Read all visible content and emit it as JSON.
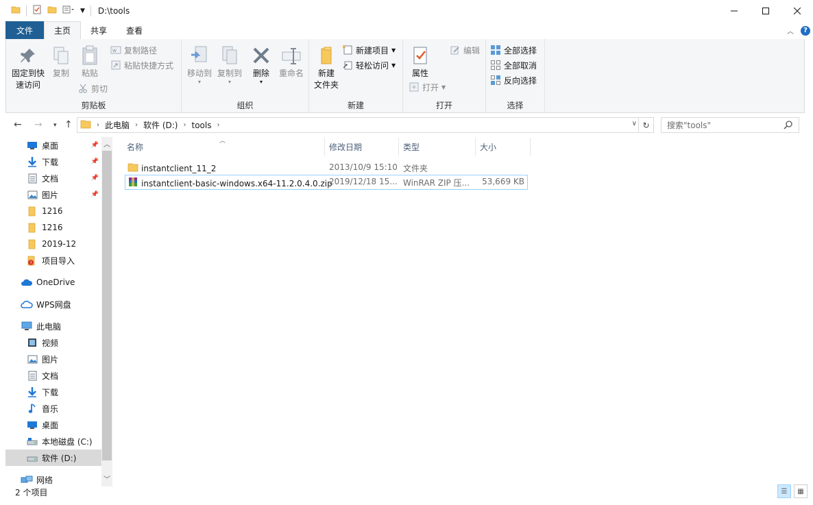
{
  "window": {
    "title": "D:\\tools"
  },
  "ribbon_tabs": [
    "文件",
    "主页",
    "共享",
    "查看"
  ],
  "ribbon": {
    "clipboard": {
      "label": "剪贴板",
      "pin_label_1": "固定到快",
      "pin_label_2": "速访问",
      "copy": "复制",
      "paste": "粘贴",
      "copy_path": "复制路径",
      "paste_shortcut": "粘贴快捷方式",
      "cut": "剪切"
    },
    "organize": {
      "label": "组织",
      "move_to": "移动到",
      "copy_to": "复制到",
      "delete": "删除",
      "rename": "重命名"
    },
    "new": {
      "label": "新建",
      "new_folder_1": "新建",
      "new_folder_2": "文件夹",
      "new_item": "新建项目",
      "easy_access": "轻松访问"
    },
    "open": {
      "label": "打开",
      "properties": "属性",
      "open": "打开",
      "edit": "编辑"
    },
    "select": {
      "label": "选择",
      "select_all": "全部选择",
      "select_none": "全部取消",
      "invert": "反向选择"
    }
  },
  "address": {
    "segments": [
      "此电脑",
      "软件 (D:)",
      "tools"
    ],
    "search_placeholder": "搜索\"tools\""
  },
  "nav": {
    "quick": [
      {
        "label": "桌面",
        "icon": "desktop-icon",
        "pinned": true
      },
      {
        "label": "下载",
        "icon": "download-icon",
        "pinned": true
      },
      {
        "label": "文档",
        "icon": "document-icon",
        "pinned": true
      },
      {
        "label": "图片",
        "icon": "pictures-icon",
        "pinned": true
      },
      {
        "label": "1216",
        "icon": "folder-icon",
        "pinned": false
      },
      {
        "label": "1216",
        "icon": "folder-icon",
        "pinned": false
      },
      {
        "label": "2019-12",
        "icon": "folder-icon",
        "pinned": false
      },
      {
        "label": "项目导入",
        "icon": "folder-warning-icon",
        "pinned": false
      }
    ],
    "onedrive": "OneDrive",
    "wps": "WPS网盘",
    "thispc": "此电脑",
    "pc_items": [
      {
        "label": "视频",
        "icon": "video-icon"
      },
      {
        "label": "图片",
        "icon": "pictures-icon"
      },
      {
        "label": "文档",
        "icon": "document-icon"
      },
      {
        "label": "下载",
        "icon": "download-icon"
      },
      {
        "label": "音乐",
        "icon": "music-icon"
      },
      {
        "label": "桌面",
        "icon": "desktop-icon"
      },
      {
        "label": "本地磁盘 (C:)",
        "icon": "drive-icon"
      },
      {
        "label": "软件 (D:)",
        "icon": "drive-icon"
      }
    ],
    "network": "网络"
  },
  "columns": {
    "name": "名称",
    "modified": "修改日期",
    "type": "类型",
    "size": "大小"
  },
  "files": [
    {
      "name": "instantclient_11_2",
      "modified": "2013/10/9 15:10",
      "type": "文件夹",
      "size": "",
      "icon": "folder-icon"
    },
    {
      "name": "instantclient-basic-windows.x64-11.2.0.4.0.zip",
      "modified": "2019/12/18 15...",
      "type": "WinRAR ZIP 压...",
      "size": "53,669 KB",
      "icon": "winrar-zip-icon"
    }
  ],
  "status": {
    "count": "2 个项目"
  },
  "colors": {
    "file_tab": "#1f5f94",
    "selection": "#cce8ff",
    "selection_border": "#99d1ff",
    "folder": "#f7c85c"
  }
}
